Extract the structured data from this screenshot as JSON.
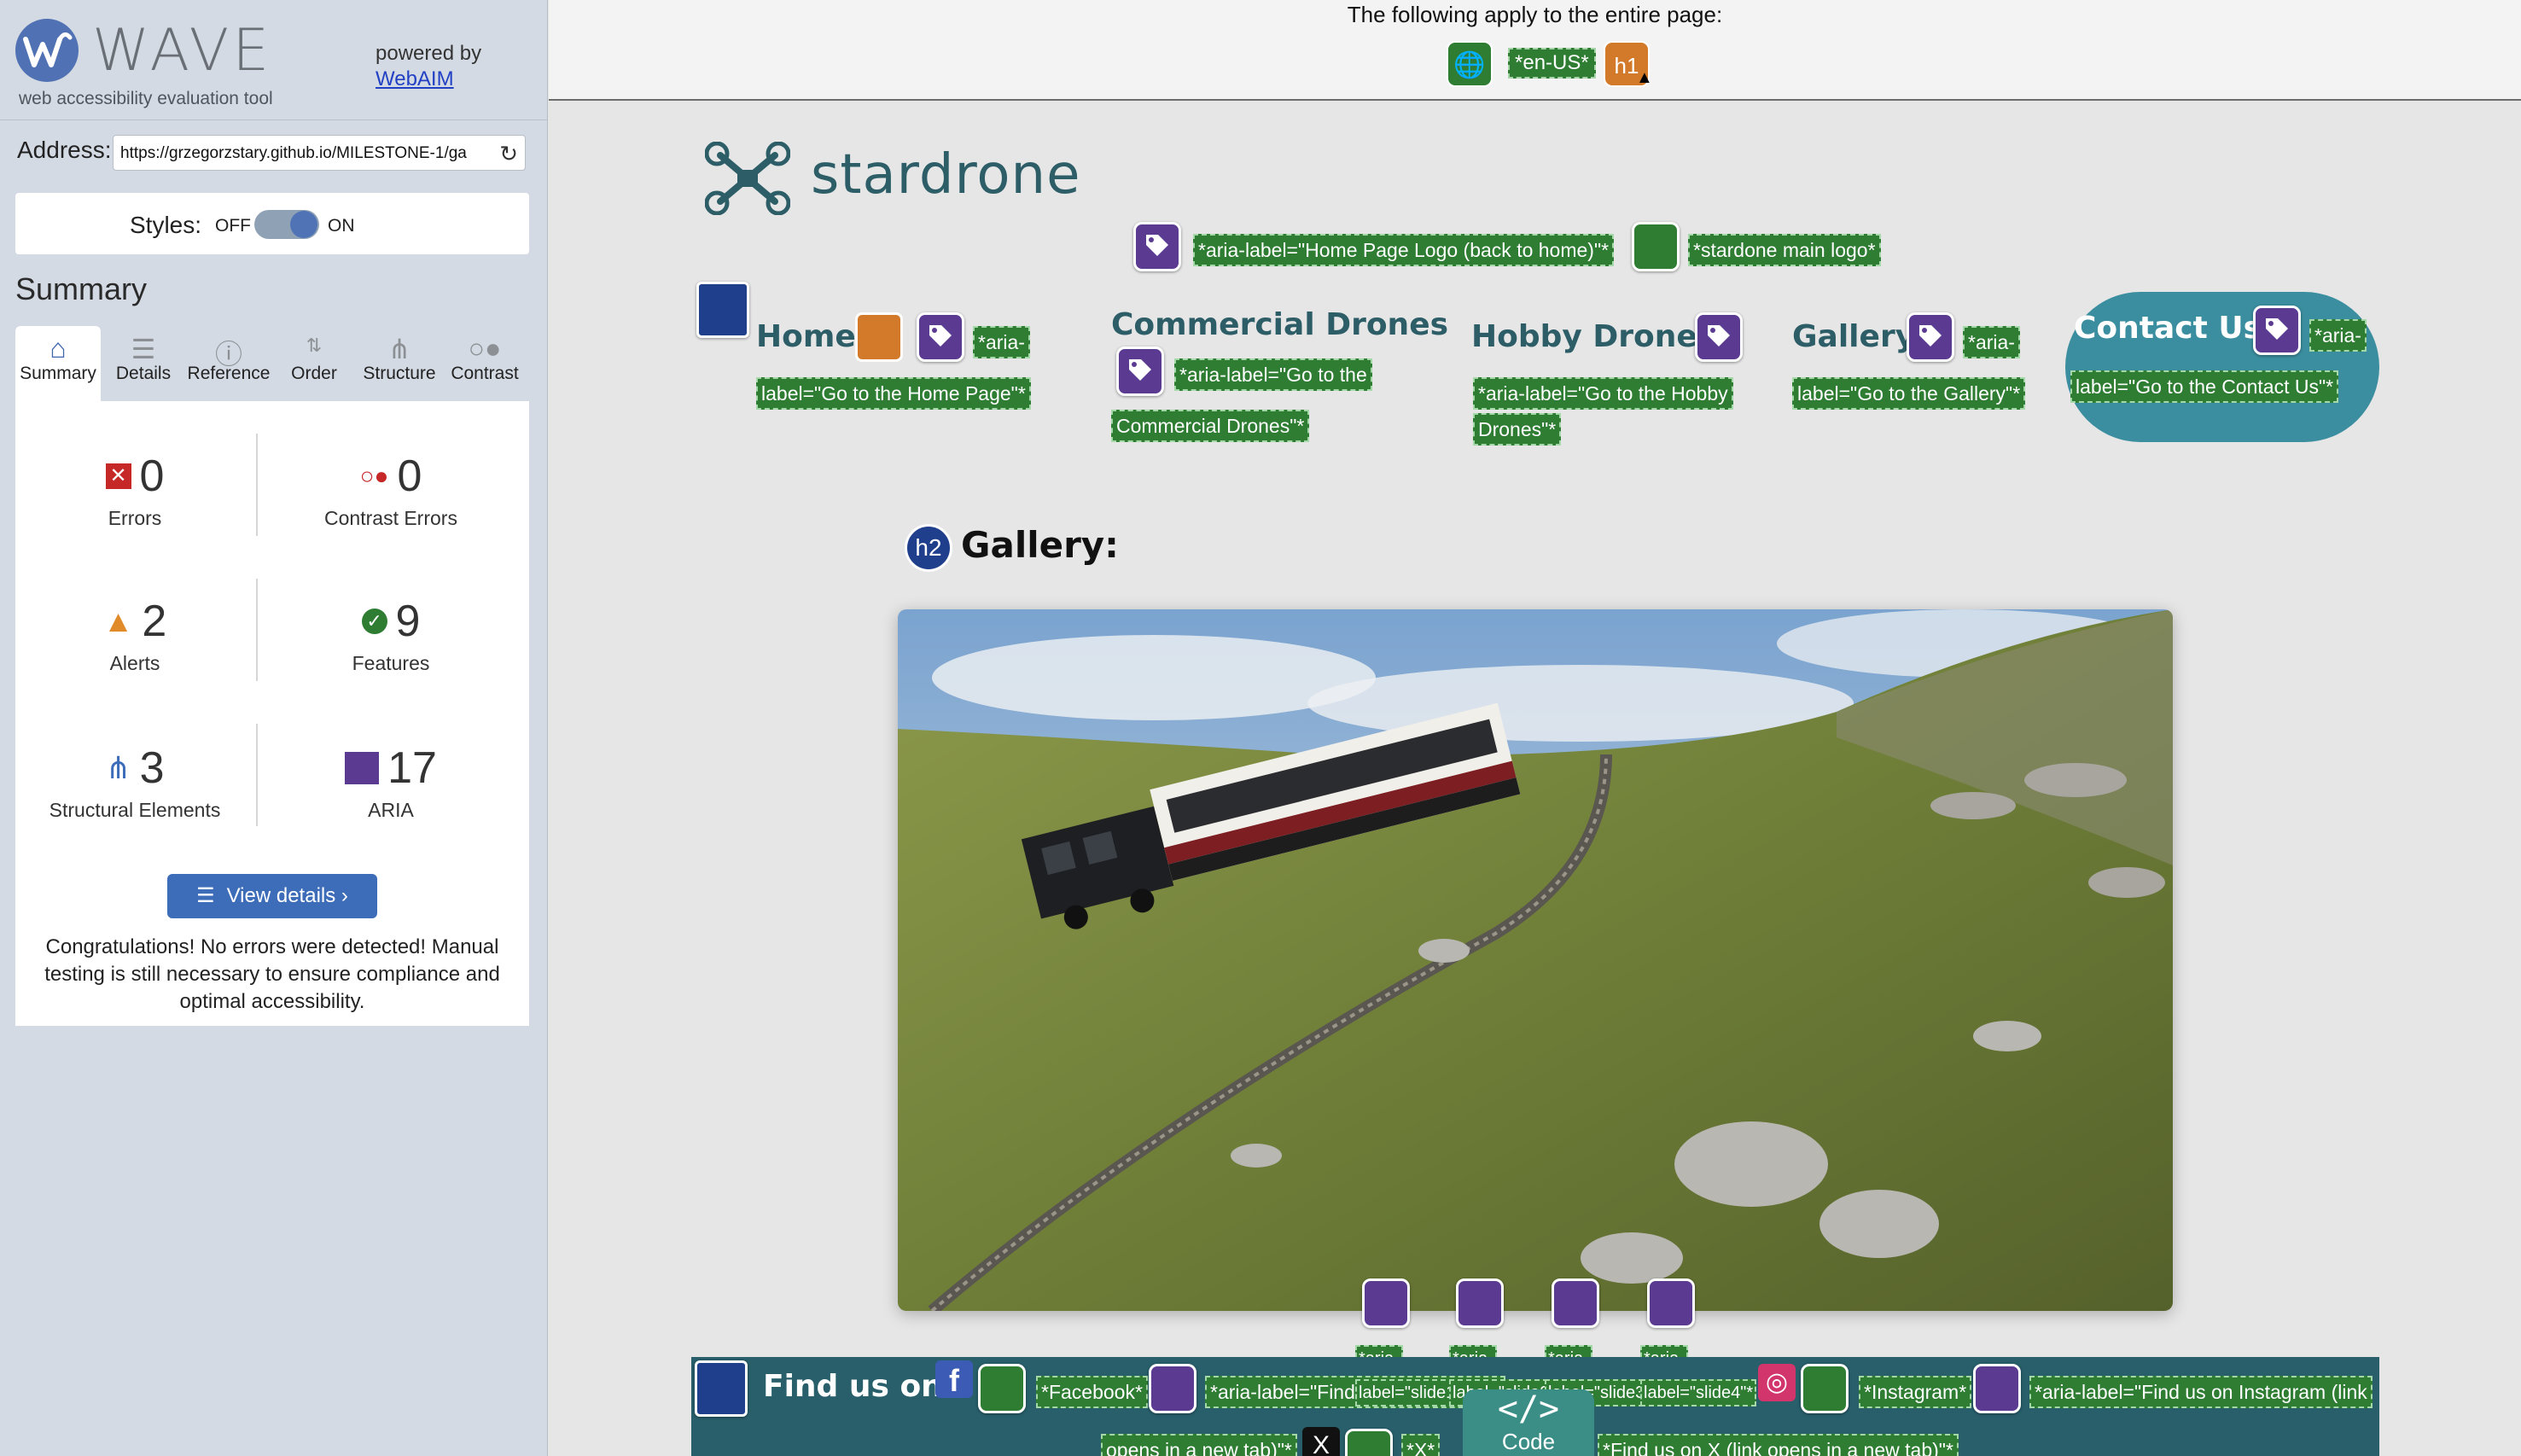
{
  "wave": {
    "logo_text": "WAVE",
    "logo_sub": "web accessibility evaluation tool",
    "powered_by": "powered by",
    "webaim_link": "WebAIM",
    "address_label": "Address:",
    "address_value": "https://grzegorzstary.github.io/MILESTONE-1/ga",
    "styles_label": "Styles:",
    "styles_off": "OFF",
    "styles_on": "ON",
    "styles_state": "on",
    "summary_heading": "Summary",
    "tabs": [
      {
        "label": "Summary",
        "icon": "home-icon"
      },
      {
        "label": "Details",
        "icon": "list-icon"
      },
      {
        "label": "Reference",
        "icon": "info-icon"
      },
      {
        "label": "Order",
        "icon": "order-icon"
      },
      {
        "label": "Structure",
        "icon": "structure-icon"
      },
      {
        "label": "Contrast",
        "icon": "contrast-icon"
      }
    ],
    "stats": {
      "errors": {
        "value": "0",
        "label": "Errors"
      },
      "contrast_errors": {
        "value": "0",
        "label": "Contrast Errors"
      },
      "alerts": {
        "value": "2",
        "label": "Alerts"
      },
      "features": {
        "value": "9",
        "label": "Features"
      },
      "structural": {
        "value": "3",
        "label": "Structural Elements"
      },
      "aria": {
        "value": "17",
        "label": "ARIA"
      }
    },
    "view_details": "View details ›",
    "congrats": "Congratulations! No errors were detected! Manual testing is still necessary to ensure compliance and optimal accessibility.",
    "colors": {
      "accent": "#3d6cb8",
      "sidebar_bg": "#d3dae3",
      "error": "#c62828",
      "alert": "#e08a2a",
      "feature": "#2e7d32",
      "aria": "#5b3b92"
    }
  },
  "banner": {
    "text": "The following apply to the entire page:",
    "lang_tag": "*en-US*",
    "h1_label": "h1"
  },
  "site": {
    "logo_text": "stardrone",
    "logo_aria": "*aria-label=\"Home Page Logo (back to home)\"*",
    "logo_alt": "*stardone main logo*",
    "nav": {
      "home": "Home",
      "home_aria_1": "*aria-",
      "home_aria_2": "label=\"Go to the Home Page\"*",
      "commercial": "Commercial Drones",
      "commercial_aria_1": "*aria-label=\"Go to the",
      "commercial_aria_2": "Commercial Drones\"*",
      "hobby": "Hobby Drones",
      "hobby_aria_1": "*aria-label=\"Go to the Hobby",
      "hobby_aria_2": "Drones\"*",
      "gallery": "Gallery",
      "gallery_aria_1": "*aria-",
      "gallery_aria_2": "label=\"Go to the Gallery\"*",
      "contact": "Contact Us!",
      "contact_aria_1": "*aria-",
      "contact_aria_2": "label=\"Go to the Contact Us\"*"
    },
    "h2_badge": "h2",
    "gallery_heading": "Gallery:",
    "slides": [
      {
        "line1": "*aria-",
        "line2": "label=\"slide1\"*"
      },
      {
        "line1": "*aria-",
        "line2": "label=\"slide2\"*"
      },
      {
        "line1": "*aria-",
        "line2": "label=\"slide3\"*"
      },
      {
        "line1": "*aria-",
        "line2": "label=\"slide4\"*"
      }
    ],
    "footer": {
      "find_us": "Find us on:",
      "facebook": "*Facebook*",
      "facebook_aria": "*aria-label=\"Find us on Facebook",
      "instagram": "*Instagram*",
      "instagram_aria": "*aria-label=\"Find us on Instagram (link",
      "line2_left": "opens in a new tab)\"*",
      "x_tag": "*X*",
      "x_aria": "*Find us on X (link opens in a new tab)\"*"
    },
    "code_label": "Code",
    "code_symbol": "</>",
    "colors": {
      "brand": "#2d5e67",
      "contact_bg": "#3a8e9f",
      "footer_bg": "#285f6b"
    }
  }
}
